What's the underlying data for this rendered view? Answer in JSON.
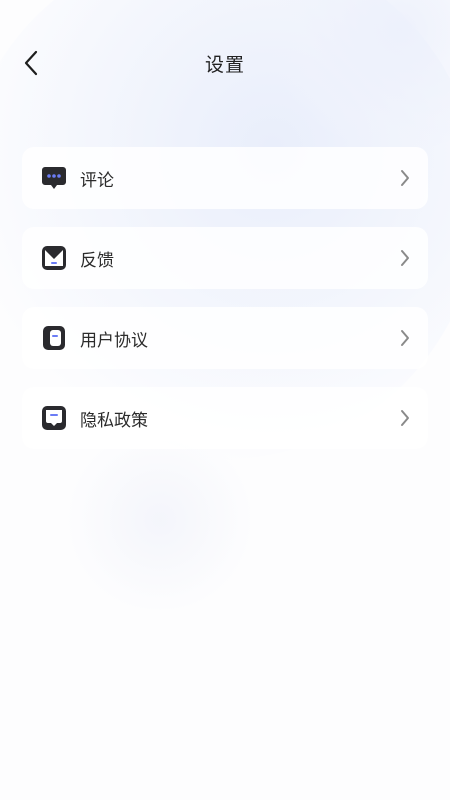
{
  "header": {
    "title": "设置",
    "back_icon": "chevron-left-icon"
  },
  "menu": {
    "items": [
      {
        "label": "评论",
        "icon": "comment-bubble-icon"
      },
      {
        "label": "反馈",
        "icon": "feedback-envelope-icon"
      },
      {
        "label": "用户协议",
        "icon": "user-agreement-icon"
      },
      {
        "label": "隐私政策",
        "icon": "privacy-policy-icon"
      }
    ],
    "chevron_icon": "chevron-right-icon"
  },
  "colors": {
    "icon_dark": "#2a2a2e",
    "icon_accent": "#6b7cf5",
    "chevron": "#8a8a8a",
    "background": "#fdfdfe"
  }
}
